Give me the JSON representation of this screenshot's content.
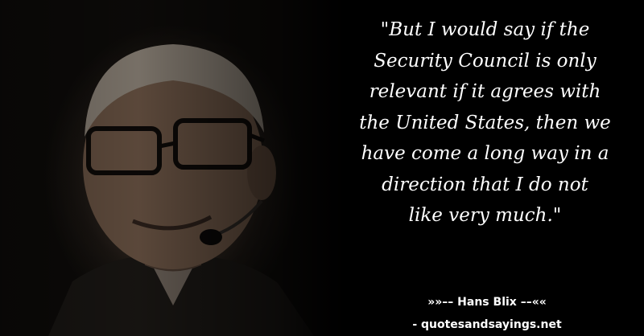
{
  "quote": {
    "lines": [
      "\"But I would say if the",
      "Security Council is only",
      "relevant if it agrees with",
      "the United States, then we",
      "have come a long way in a",
      "direction that I do not",
      "like very much.\""
    ]
  },
  "author": "»»–– Hans Blix ––««",
  "site": "- quotesandsayings.net",
  "colors": {
    "background": "#000000",
    "text": "#ffffff"
  }
}
